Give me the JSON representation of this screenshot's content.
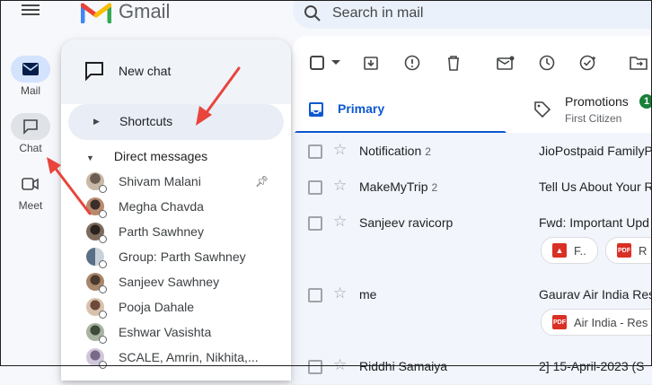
{
  "app": {
    "logo_text": "Gmail"
  },
  "search": {
    "placeholder": "Search in mail"
  },
  "rail": {
    "items": [
      {
        "label": "Mail",
        "icon": "mail-icon"
      },
      {
        "label": "Chat",
        "icon": "chat-icon"
      },
      {
        "label": "Meet",
        "icon": "video-icon"
      }
    ]
  },
  "chat_panel": {
    "new_chat_label": "New chat",
    "shortcuts_label": "Shortcuts",
    "dm_header": "Direct messages",
    "contacts": [
      "Shivam Malani",
      "Megha Chavda",
      "Parth Sawhney",
      "Group: Parth Sawhney",
      "Sanjeev Sawhney",
      "Pooja Dahale",
      "Eshwar Vasishta",
      "SCALE, Amrin, Nikhita,..."
    ]
  },
  "tabs": {
    "primary": "Primary",
    "promotions": "Promotions",
    "promotions_sub": "First Citizen",
    "promotions_badge": "1"
  },
  "emails": [
    {
      "sender": "Notification",
      "count": "2",
      "subject": "JioPostpaid FamilyPl"
    },
    {
      "sender": "MakeMyTrip",
      "count": "2",
      "subject": "Tell Us About Your R"
    },
    {
      "sender": "Sanjeev ravicorp",
      "count": "",
      "subject": "Fwd: Important Upd"
    },
    {
      "sender": "me",
      "count": "",
      "subject": "Gaurav Air India Res"
    },
    {
      "sender": "Riddhi Samaiya",
      "count": "",
      "subject": "2] 15-April-2023 (S"
    }
  ],
  "attachments": {
    "row3_chip1": "F..",
    "row3_chip2": "R",
    "row4_chip1": "Air India - Res"
  },
  "colors": {
    "accent": "#0b57d0",
    "arrow": "#e8453c",
    "rail_active": "#d3e3fd"
  }
}
